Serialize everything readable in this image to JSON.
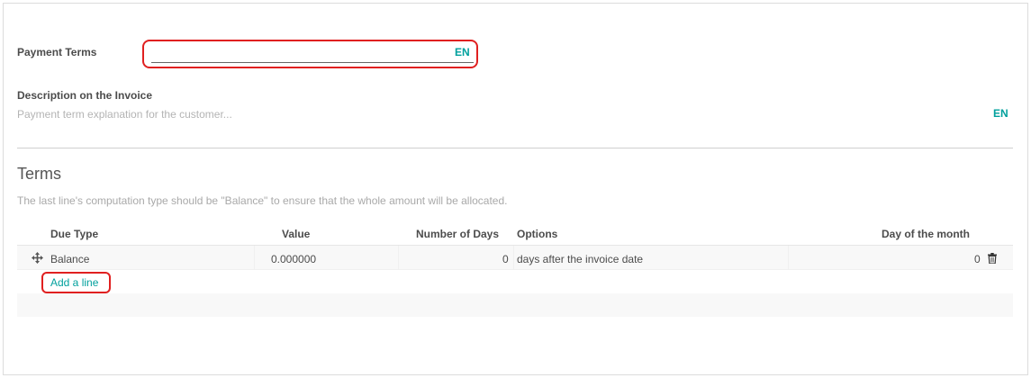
{
  "form": {
    "name_label": "Payment Terms",
    "name_value": "",
    "name_lang": "EN",
    "description_label": "Description on the Invoice",
    "description_placeholder": "Payment term explanation for the customer...",
    "description_value": "",
    "description_lang": "EN"
  },
  "terms": {
    "title": "Terms",
    "help_text": "The last line's computation type should be \"Balance\" to ensure that the whole amount will be allocated.",
    "columns": [
      "Due Type",
      "Value",
      "Number of Days",
      "Options",
      "Day of the month"
    ],
    "rows": [
      {
        "due_type": "Balance",
        "value": "0.000000",
        "number_of_days": "0",
        "options": "days after the invoice date",
        "day_of_month": "0"
      }
    ],
    "add_line_label": "Add a line"
  },
  "icons": {
    "drag_handle": "move-arrows-icon",
    "delete": "trash-icon"
  },
  "colors": {
    "accent": "#00a09d",
    "highlight": "#e02020",
    "text": "#4c4c4c",
    "muted": "#a9a9a9"
  }
}
